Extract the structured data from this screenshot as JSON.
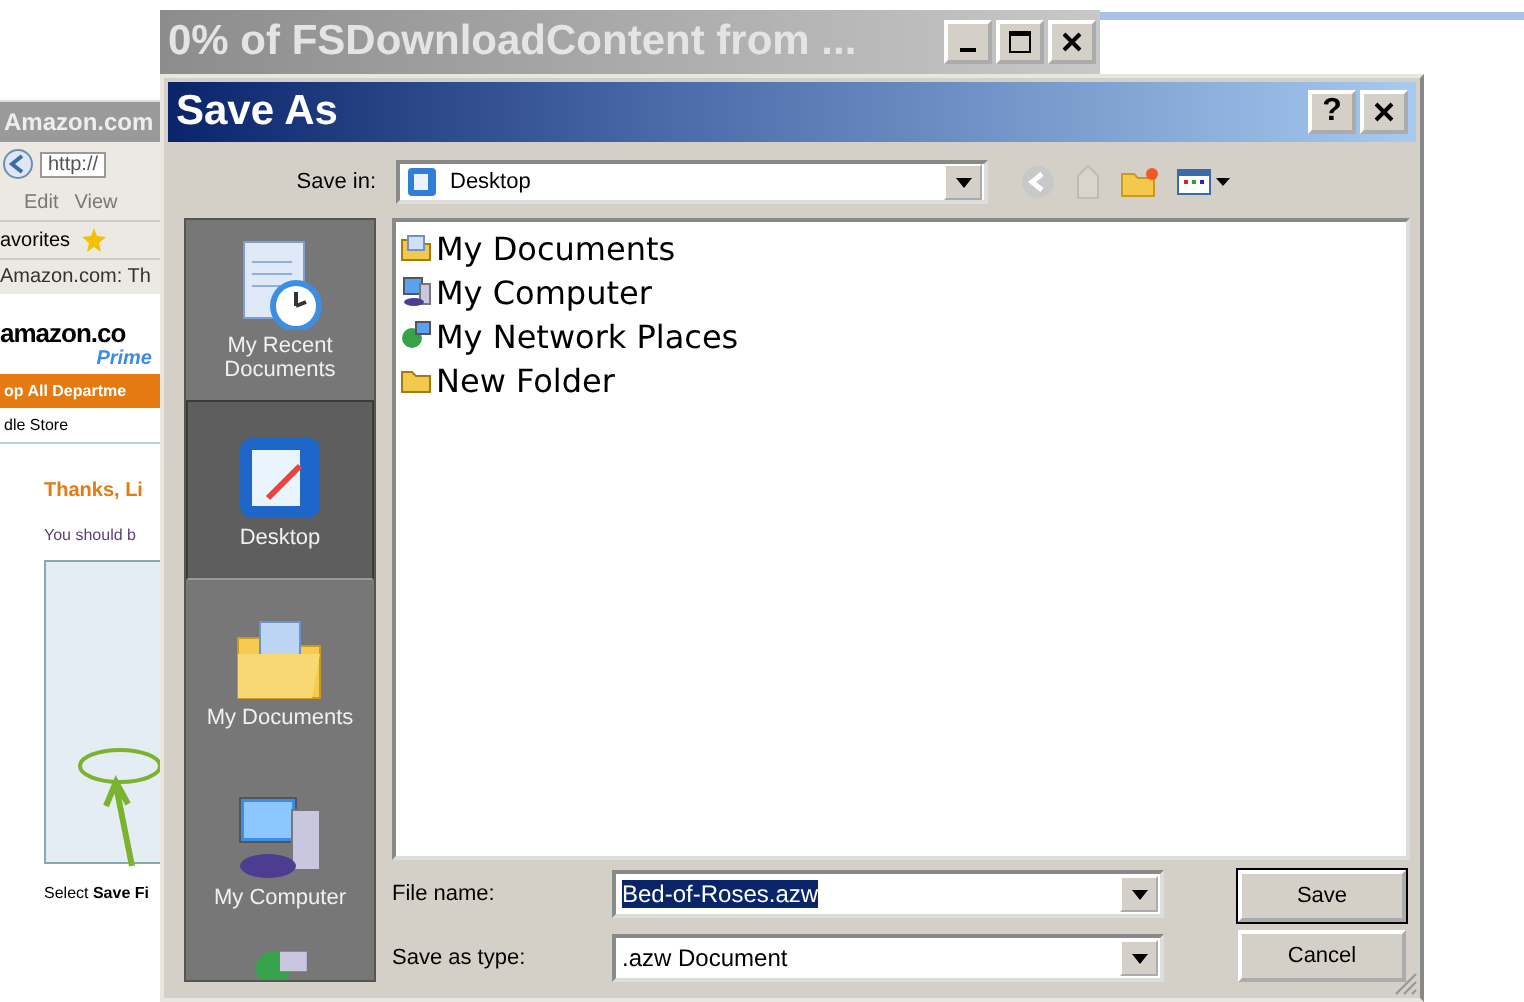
{
  "browser": {
    "title": "Amazon.com",
    "address": "http://",
    "menu": [
      "Edit",
      "View"
    ],
    "favorites": "avorites",
    "tab": "Amazon.com: Th",
    "logo": "amazon.co",
    "logo_sub": "Prime",
    "nav": "op All Departme",
    "subnav": "dle Store",
    "heading": "Thanks, Li",
    "text": "You should b",
    "caption": "Select **Save Fi**"
  },
  "download_window": {
    "title": "0% of FSDownloadContent from ..."
  },
  "dialog": {
    "title": "Save As",
    "help": "?",
    "save_in_label": "Save in:",
    "save_in": "Desktop",
    "places": [
      {
        "kind": "recent",
        "label": "My Recent Documents",
        "selected": false
      },
      {
        "kind": "desktop",
        "label": "Desktop",
        "selected": true
      },
      {
        "kind": "documents",
        "label": "My Documents",
        "selected": false
      },
      {
        "kind": "computer",
        "label": "My Computer",
        "selected": false
      },
      {
        "kind": "network",
        "selected": false
      }
    ],
    "files": [
      {
        "kind": "documents",
        "name": "My Documents"
      },
      {
        "kind": "computer",
        "name": "My Computer"
      },
      {
        "kind": "network",
        "name": "My Network Places"
      },
      {
        "kind": "folder",
        "name": "New Folder"
      }
    ],
    "file_name_label": "File name:",
    "file_name": "Bed-of-Roses.azw",
    "file_name_highlighted": true,
    "type_label": "Save as type:",
    "type": ".azw Document",
    "buttons": [
      "Save",
      "Cancel"
    ]
  }
}
